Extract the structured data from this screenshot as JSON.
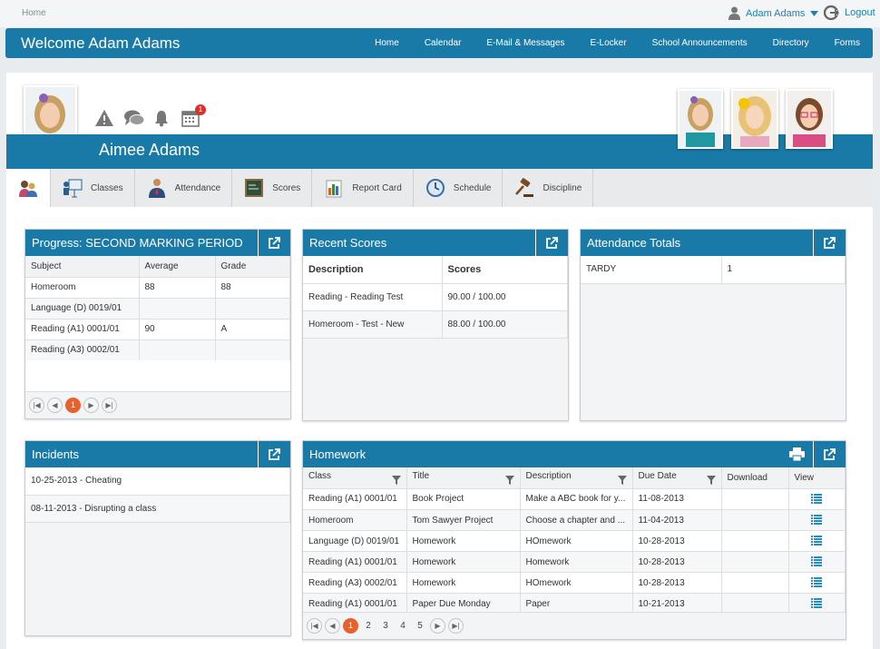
{
  "topbar": {
    "breadcrumb": "Home",
    "user_name": "Adam Adams",
    "logout": "Logout"
  },
  "navbar": {
    "welcome": "Welcome Adam Adams",
    "links": [
      "Home",
      "Calendar",
      "E-Mail & Messages",
      "E-Locker",
      "School Announcements",
      "Directory",
      "Forms"
    ]
  },
  "profile": {
    "student_name": "Aimee Adams",
    "calendar_badge": "1",
    "alert_icons": [
      "warning-icon",
      "chat-icon",
      "bell-icon",
      "calendar-icon"
    ]
  },
  "tabs": [
    "Classes",
    "Attendance",
    "Scores",
    "Report Card",
    "Schedule",
    "Discipline"
  ],
  "progress": {
    "title": "Progress: SECOND MARKING PERIOD",
    "columns": [
      "Subject",
      "Average",
      "Grade"
    ],
    "rows": [
      [
        "Homeroom",
        "88",
        "88"
      ],
      [
        "Language (D) 0019/01",
        "",
        ""
      ],
      [
        "Reading (A1) 0001/01",
        "90",
        "A"
      ],
      [
        "Reading (A3) 0002/01",
        "",
        ""
      ]
    ],
    "page": "1"
  },
  "recent_scores": {
    "title": "Recent Scores",
    "columns": [
      "Description",
      "Scores"
    ],
    "rows": [
      [
        "Reading - Reading Test",
        "90.00 / 100.00"
      ],
      [
        "Homeroom - Test - New",
        "88.00 / 100.00"
      ]
    ]
  },
  "attendance": {
    "title": "Attendance Totals",
    "rows": [
      [
        "TARDY",
        "1"
      ]
    ]
  },
  "incidents": {
    "title": "Incidents",
    "rows": [
      "10-25-2013 - Cheating",
      "08-11-2013 - Disrupting a class"
    ]
  },
  "homework": {
    "title": "Homework",
    "columns": [
      "Class",
      "Title",
      "Description",
      "Due Date",
      "Download",
      "View"
    ],
    "rows": [
      [
        "Reading (A1) 0001/01",
        "Book Project",
        "Make a ABC book for y...",
        "11-08-2013"
      ],
      [
        "Homeroom",
        "Tom Sawyer Project",
        "Choose a chapter and ...",
        "11-04-2013"
      ],
      [
        "Language (D) 0019/01",
        "Homework",
        "HOmework",
        "10-28-2013"
      ],
      [
        "Reading (A1) 0001/01",
        "Homework",
        "Homework",
        "10-28-2013"
      ],
      [
        "Reading (A3) 0002/01",
        "Homework",
        "HOmework",
        "10-28-2013"
      ],
      [
        "Reading (A1) 0001/01",
        "Paper Due Monday",
        "Paper",
        "10-21-2013"
      ]
    ],
    "pages": [
      "1",
      "2",
      "3",
      "4",
      "5"
    ]
  },
  "colors": {
    "brand": "#1a7aa7",
    "accent": "#e8612c",
    "badge": "#d9322c"
  }
}
